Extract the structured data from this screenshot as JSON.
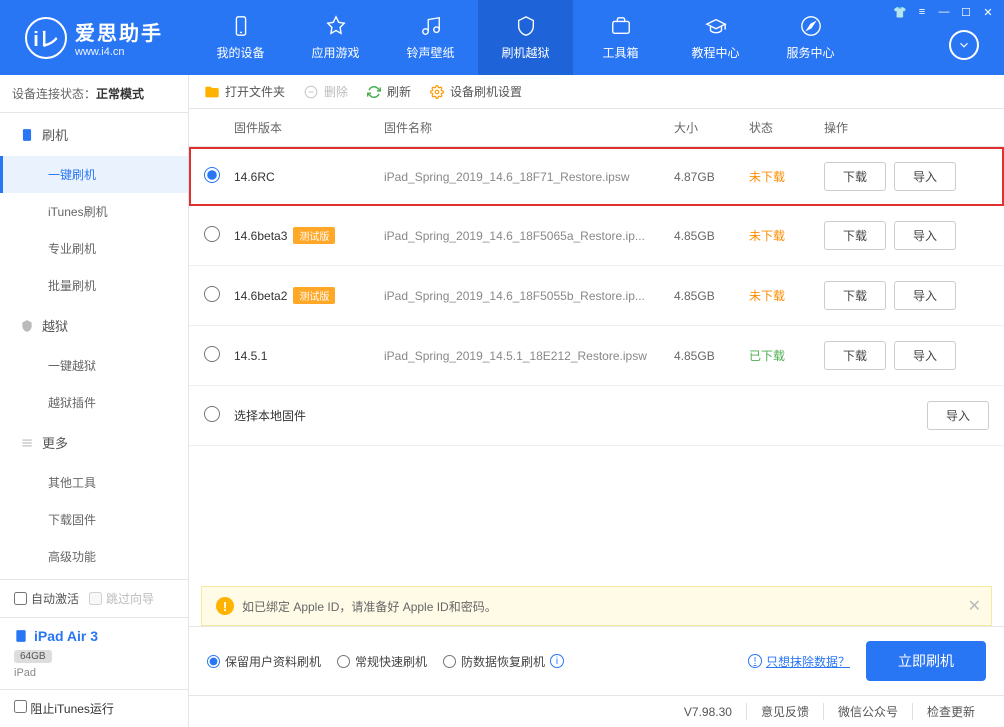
{
  "app": {
    "title": "爱思助手",
    "url": "www.i4.cn"
  },
  "nav": [
    {
      "label": "我的设备"
    },
    {
      "label": "应用游戏"
    },
    {
      "label": "铃声壁纸"
    },
    {
      "label": "刷机越狱"
    },
    {
      "label": "工具箱"
    },
    {
      "label": "教程中心"
    },
    {
      "label": "服务中心"
    }
  ],
  "sidebar": {
    "status_label": "设备连接状态：",
    "status_value": "正常模式",
    "groups": [
      {
        "title": "刷机",
        "items": [
          "一键刷机",
          "iTunes刷机",
          "专业刷机",
          "批量刷机"
        ]
      },
      {
        "title": "越狱",
        "items": [
          "一键越狱",
          "越狱插件"
        ]
      },
      {
        "title": "更多",
        "items": [
          "其他工具",
          "下载固件",
          "高级功能"
        ]
      }
    ],
    "auto_activate": "自动激活",
    "skip_guide": "跳过向导",
    "device_name": "iPad Air 3",
    "device_storage": "64GB",
    "device_type": "iPad",
    "stop_itunes": "阻止iTunes运行"
  },
  "toolbar": {
    "open": "打开文件夹",
    "delete": "删除",
    "refresh": "刷新",
    "settings": "设备刷机设置"
  },
  "table": {
    "h_version": "固件版本",
    "h_name": "固件名称",
    "h_size": "大小",
    "h_status": "状态",
    "h_action": "操作"
  },
  "rows": [
    {
      "version": "14.6RC",
      "beta": false,
      "name": "iPad_Spring_2019_14.6_18F71_Restore.ipsw",
      "size": "4.87GB",
      "status": "未下载",
      "done": false,
      "selected": true,
      "highlight": true
    },
    {
      "version": "14.6beta3",
      "beta": true,
      "name": "iPad_Spring_2019_14.6_18F5065a_Restore.ip...",
      "size": "4.85GB",
      "status": "未下载",
      "done": false,
      "selected": false,
      "highlight": false
    },
    {
      "version": "14.6beta2",
      "beta": true,
      "name": "iPad_Spring_2019_14.6_18F5055b_Restore.ip...",
      "size": "4.85GB",
      "status": "未下载",
      "done": false,
      "selected": false,
      "highlight": false
    },
    {
      "version": "14.5.1",
      "beta": false,
      "name": "iPad_Spring_2019_14.5.1_18E212_Restore.ipsw",
      "size": "4.85GB",
      "status": "已下载",
      "done": true,
      "selected": false,
      "highlight": false
    }
  ],
  "local_fw": "选择本地固件",
  "beta_tag": "测试版",
  "btn_download": "下载",
  "btn_import": "导入",
  "notice": "如已绑定 Apple ID，请准备好 Apple ID和密码。",
  "options": {
    "keep": "保留用户资料刷机",
    "normal": "常规快速刷机",
    "anti": "防数据恢复刷机"
  },
  "erase_link": "只想抹除数据？",
  "flash_btn": "立即刷机",
  "status": {
    "version": "V7.98.30",
    "feedback": "意见反馈",
    "wechat": "微信公众号",
    "update": "检查更新"
  }
}
